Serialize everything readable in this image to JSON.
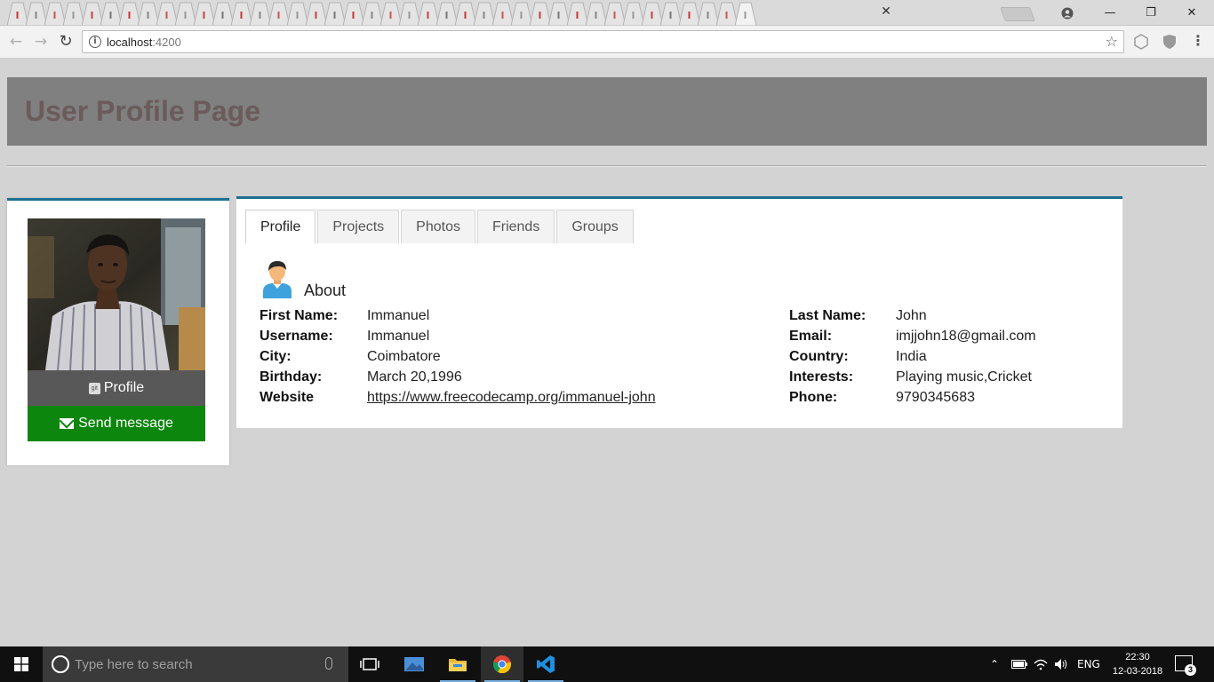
{
  "browser": {
    "tab_count_favicons": 40,
    "active_tab_close": "✕",
    "window_controls": {
      "minimize": "—",
      "maximize": "❐",
      "close": "✕"
    },
    "address": {
      "host": "localhost",
      "port": ":4200"
    },
    "icons": [
      "back-icon",
      "forward-icon",
      "reload-icon",
      "info-icon",
      "star-icon",
      "extension-icon",
      "menu-icon",
      "account-icon"
    ]
  },
  "page": {
    "title": "User Profile Page",
    "header_bg": "#808080",
    "title_color": "#6b5b5b",
    "accent": "#1d6f8f"
  },
  "sidebar": {
    "profile_button": "Profile",
    "git_badge": "git",
    "message_button": "Send message",
    "message_button_color": "#0c860c"
  },
  "tabs": [
    {
      "label": "Profile",
      "active": true
    },
    {
      "label": "Projects",
      "active": false
    },
    {
      "label": "Photos",
      "active": false
    },
    {
      "label": "Friends",
      "active": false
    },
    {
      "label": "Groups",
      "active": false
    }
  ],
  "about": {
    "title": "About",
    "left": [
      {
        "label": "First Name:",
        "value": "Immanuel"
      },
      {
        "label": "Username:",
        "value": "Immanuel"
      },
      {
        "label": "City:",
        "value": "Coimbatore"
      },
      {
        "label": "Birthday:",
        "value": "March 20,1996"
      },
      {
        "label": "Website",
        "value": "https://www.freecodecamp.org/immanuel-john"
      }
    ],
    "right": [
      {
        "label": "Last Name:",
        "value": "John"
      },
      {
        "label": "Email:",
        "value": "imjjohn18@gmail.com"
      },
      {
        "label": "Country:",
        "value": "India"
      },
      {
        "label": "Interests:",
        "value": "Playing music,Cricket"
      },
      {
        "label": "Phone:",
        "value": "9790345683"
      }
    ]
  },
  "taskbar": {
    "search_placeholder": "Type here to search",
    "language": "ENG",
    "time": "22:30",
    "date": "12-03-2018",
    "notifications": "3"
  }
}
